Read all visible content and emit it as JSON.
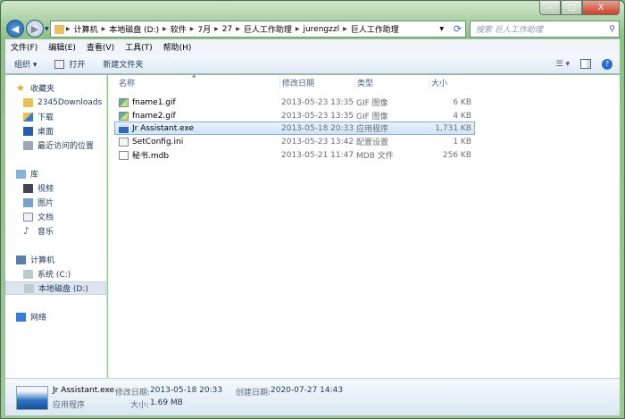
{
  "window": {
    "min": "–",
    "max": "□",
    "close": "X"
  },
  "nav": {
    "back": "◀",
    "forward": "▶"
  },
  "address": {
    "segments": [
      "计算机",
      "本地磁盘 (D:)",
      "软件",
      "7月",
      "27",
      "巨人工作助理",
      "jurengzzl",
      "巨人工作助理"
    ]
  },
  "search": {
    "placeholder": "搜索 巨人工作助理"
  },
  "menu": [
    "文件(F)",
    "编辑(E)",
    "查看(V)",
    "工具(T)",
    "帮助(H)"
  ],
  "toolbar": {
    "organize": "组织 ▾",
    "open": "打开",
    "new_folder": "新建文件夹"
  },
  "sidebar": {
    "favorites": "收藏夹",
    "fav_items": [
      "2345Downloads",
      "下载",
      "桌面",
      "最近访问的位置"
    ],
    "libraries": "库",
    "lib_items": [
      "视频",
      "图片",
      "文档",
      "音乐"
    ],
    "computer": "计算机",
    "drives": [
      "系统 (C:)",
      "本地磁盘 (D:)"
    ],
    "network": "网络"
  },
  "columns": {
    "name": "名称",
    "date": "修改日期",
    "type": "类型",
    "size": "大小"
  },
  "files": [
    {
      "name": "fname1.gif",
      "date": "2013-05-23 13:35",
      "type": "GIF 图像",
      "size": "6 KB",
      "icon": "gif-image-icon"
    },
    {
      "name": "fname2.gif",
      "date": "2013-05-23 13:35",
      "type": "GIF 图像",
      "size": "4 KB",
      "icon": "gif-image-icon"
    },
    {
      "name": "Jr Assistant.exe",
      "date": "2013-05-18 20:33",
      "type": "应用程序",
      "size": "1,731 KB",
      "icon": "exe-icon"
    },
    {
      "name": "SetConfig.ini",
      "date": "2013-05-23 13:42",
      "type": "配置设置",
      "size": "1 KB",
      "icon": "ini-icon"
    },
    {
      "name": "秘书.mdb",
      "date": "2013-05-21 11:47",
      "type": "MDB 文件",
      "size": "256 KB",
      "icon": "file-icon"
    }
  ],
  "status": {
    "name": "Jr Assistant.exe",
    "modified_label": "修改日期:",
    "modified": "2013-05-18 20:33",
    "created_label": "创建日期:",
    "created": "2020-07-27 14:43",
    "type": "应用程序",
    "size_label": "大小:",
    "size": "1.69 MB"
  }
}
